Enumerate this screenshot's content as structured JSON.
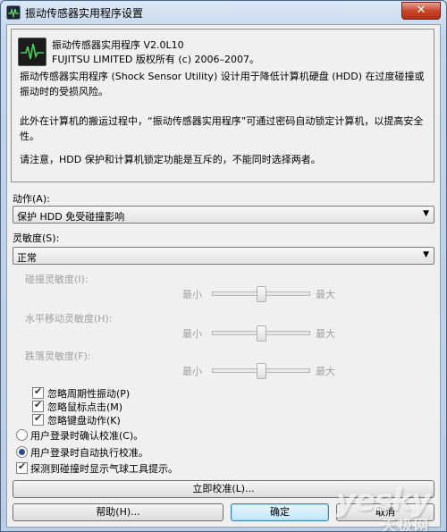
{
  "window": {
    "title": "振动传感器实用程序设置",
    "close_label": "✕"
  },
  "info": {
    "version_line": "振动传感器实用程序 V2.0L10",
    "copyright_line": "FUJITSU LIMITED 版权所有 (c) 2006–2007。",
    "para1": "振动传感器实用程序 (Shock Sensor Utility) 设计用于降低计算机硬盘 (HDD) 在过度碰撞或振动时的受损风险。",
    "para2": "此外在计算机的搬运过程中，“振动传感器实用程序”可通过密码自动锁定计算机，以提高安全性。",
    "para3": "请注意，HDD 保护和计算机锁定功能是互斥的，不能同时选择两者。"
  },
  "action": {
    "label": "动作(A):",
    "value": "保护 HDD 免受碰撞影响"
  },
  "sensitivity": {
    "label": "灵敏度(S):",
    "value": "正常"
  },
  "sliders": [
    {
      "label": "碰撞灵敏度(I):",
      "min_label": "最小",
      "max_label": "最大",
      "level": 0.5
    },
    {
      "label": "水平移动灵敏度(H):",
      "min_label": "最小",
      "max_label": "最大",
      "level": 0.5
    },
    {
      "label": "跌落灵敏度(F):",
      "min_label": "最小",
      "max_label": "最大",
      "level": 0.5
    }
  ],
  "ignore_options": [
    {
      "label": "忽略周期性振动(P)",
      "checked": true
    },
    {
      "label": "忽略鼠标点击(M)",
      "checked": true
    },
    {
      "label": "忽略键盘动作(K)",
      "checked": true
    }
  ],
  "radios": [
    {
      "label": "用户登录时确认校准(C)。",
      "selected": false
    },
    {
      "label": "用户登录时自动执行校准。",
      "selected": true
    }
  ],
  "balloon_option": {
    "label": "探测到碰撞时显示气球工具提示。",
    "checked": true
  },
  "buttons": {
    "calibrate": "立即校准(L)...",
    "help": "帮助(H)...",
    "ok": "确定",
    "cancel": "取消"
  },
  "watermark": {
    "text": "yesky",
    "cn": "天极网"
  },
  "colors": {
    "accent": "#3c7fb1",
    "radio_dot": "#2b4a8f"
  }
}
